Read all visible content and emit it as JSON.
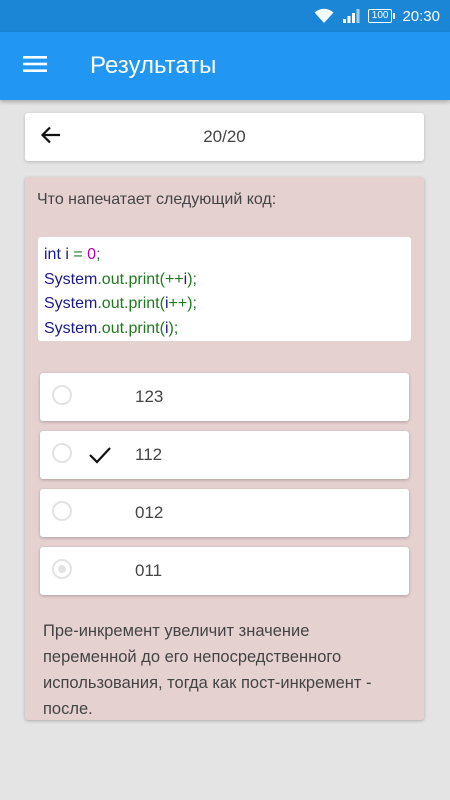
{
  "status_bar": {
    "battery": "100",
    "time": "20:30",
    "icons": [
      "wifi-icon",
      "signal-icon",
      "battery-icon"
    ]
  },
  "app_bar": {
    "title": "Результаты",
    "menu_icon": "menu-icon"
  },
  "progress": {
    "text": "20/20",
    "back_icon": "arrow-left-icon"
  },
  "question": {
    "prompt": "Что напечатает следующий код:",
    "code_lines": [
      "int i = 0;",
      "System.out.print(++i);",
      "System.out.print(i++);",
      "System.out.print(i);"
    ],
    "options": [
      {
        "label": "123",
        "checked": false,
        "selected": false
      },
      {
        "label": "112",
        "checked": true,
        "selected": false
      },
      {
        "label": "012",
        "checked": false,
        "selected": false
      },
      {
        "label": "011",
        "checked": false,
        "selected": true
      }
    ],
    "explanation": "Пре-инкремент увеличит значение переменной до его непосредственного использования, тогда как пост-инкремент - после."
  },
  "colors": {
    "status_bar": "#1b86d6",
    "app_bar": "#2196f3",
    "card_background": "#e6d1d1",
    "background": "#e4e4e4"
  }
}
